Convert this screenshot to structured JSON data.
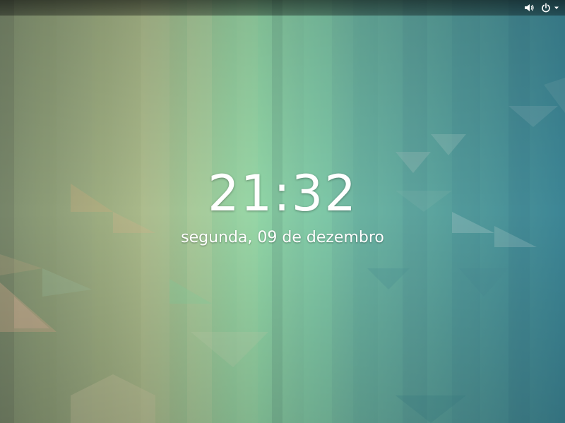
{
  "lock_screen": {
    "time": "21:32",
    "date": "segunda, 09 de dezembro"
  },
  "top_bar": {
    "status_icons": [
      "volume-icon",
      "power-icon",
      "chevron-down-icon"
    ]
  },
  "colors": {
    "text": "#ffffff",
    "top_bar_bg": "#000000"
  }
}
